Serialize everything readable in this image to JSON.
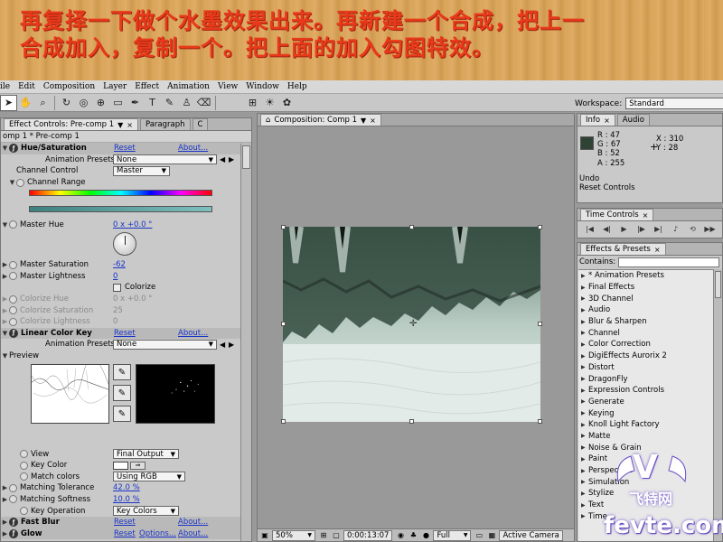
{
  "banner": {
    "line1": "再复择一下做个水墨效果出来。再新建一个合成，把上一",
    "line2": "合成加入，复制一个。把上面的加入勾图特效。"
  },
  "menu": [
    "ile",
    "Edit",
    "Composition",
    "Layer",
    "Effect",
    "Animation",
    "View",
    "Window",
    "Help"
  ],
  "workspace": {
    "label": "Workspace:",
    "value": "Standard"
  },
  "effect_controls": {
    "tabs": [
      "Effect Controls: Pre-comp 1",
      "Paragraph",
      "C"
    ],
    "subheader": "omp 1 * Pre-comp 1",
    "reset": "Reset",
    "about": "About...",
    "animation_presets_label": "Animation Presets:",
    "none": "None",
    "hue_saturation": {
      "name": "Hue/Saturation",
      "channel_control_label": "Channel Control",
      "channel_control_value": "Master",
      "channel_range_label": "Channel Range",
      "master_hue_label": "Master Hue",
      "master_hue_value": "0 x +0.0 °",
      "master_saturation_label": "Master Saturation",
      "master_saturation_value": "-62",
      "master_lightness_label": "Master Lightness",
      "master_lightness_value": "0",
      "colorize_label": "Colorize",
      "colorize_hue_label": "Colorize Hue",
      "colorize_hue_value": "0 x +0.0 °",
      "colorize_saturation_label": "Colorize Saturation",
      "colorize_saturation_value": "25",
      "colorize_lightness_label": "Colorize Lightness",
      "colorize_lightness_value": "0"
    },
    "linear_color_key": {
      "name": "Linear Color Key",
      "preview_label": "Preview",
      "view_label": "View",
      "view_value": "Final Output",
      "key_color_label": "Key Color",
      "match_colors_label": "Match colors",
      "match_colors_value": "Using RGB",
      "matching_tolerance_label": "Matching Tolerance",
      "matching_tolerance_value": "42.0 %",
      "matching_softness_label": "Matching Softness",
      "matching_softness_value": "10.0 %",
      "key_operation_label": "Key Operation",
      "key_operation_value": "Key Colors"
    },
    "fast_blur": {
      "name": "Fast Blur"
    },
    "glow": {
      "name": "Glow",
      "options": "Options..."
    }
  },
  "composition": {
    "tab": "Composition: Comp 1",
    "zoom": "50%",
    "timecode": "0:00:13:07",
    "resolution": "Full",
    "camera": "Active Camera"
  },
  "info": {
    "tabs": [
      "Info",
      "Audio"
    ],
    "r": "R : 47",
    "g": "G : 67",
    "b": "B : 52",
    "a": "A : 255",
    "x": "X : 310",
    "y": "Y : 28",
    "undo": "Undo",
    "reset_controls": "Reset Controls",
    "swatch_color": "#2f4334"
  },
  "time_controls": {
    "tab": "Time Controls"
  },
  "effects_presets": {
    "tab": "Effects & Presets",
    "contains_label": "Contains:",
    "items": [
      "* Animation Presets",
      "Final Effects",
      "3D Channel",
      "Audio",
      "Blur & Sharpen",
      "Channel",
      "Color Correction",
      "DigiEffects Aurorix 2",
      "Distort",
      "DragonFly",
      "Expression Controls",
      "Generate",
      "Keying",
      "Knoll Light Factory",
      "Matte",
      "Noise & Grain",
      "Paint",
      "Perspective",
      "Simulation",
      "Stylize",
      "Text",
      "Time"
    ]
  },
  "watermark": {
    "v": "V",
    "cn": "飞特网",
    "url": "fevte.com"
  },
  "colors": {
    "link": "#1a34c8",
    "banner_text": "#e83a1a",
    "panel": "#c9c9c9"
  }
}
